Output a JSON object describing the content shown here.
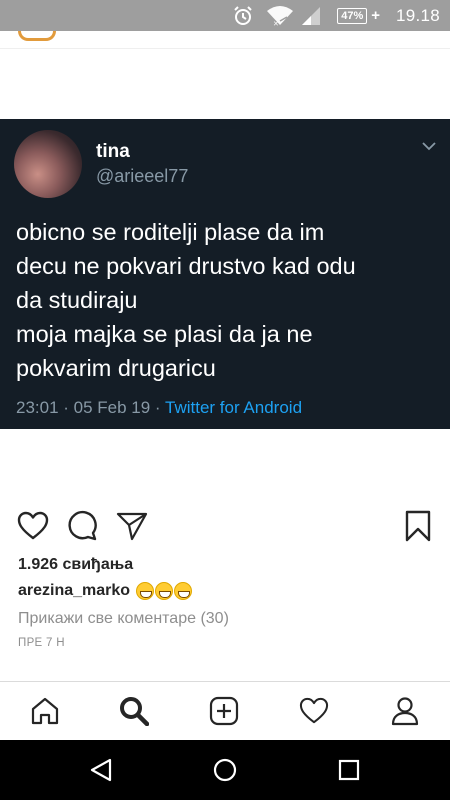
{
  "status_bar": {
    "time": "19.18",
    "battery": "47%",
    "icons": [
      "alarm-icon",
      "wifi-icon",
      "signal-icon",
      "battery-charging-icon"
    ]
  },
  "tweet": {
    "name": "tina",
    "handle": "@arieeel77",
    "text": "obicno se roditelji plase da im\ndecu ne pokvari drustvo kad odu\nda studiraju\nmoja majka se plasi da ja ne\npokvarim drugaricu",
    "timestamp": "23:01 · 05 Feb 19 · ",
    "source": "Twitter for Android"
  },
  "post": {
    "likes": "1.926 свиђања",
    "caption_user": "arezina_marko",
    "caption_emojis": [
      "laughing-emoji",
      "laughing-emoji",
      "laughing-emoji"
    ],
    "view_comments": "Прикажи све коментаре (30)",
    "time_ago": "ПРЕ 7 Н"
  },
  "bottom_nav": [
    "home-icon",
    "search-icon",
    "add-post-icon",
    "activity-heart-icon",
    "profile-icon"
  ],
  "system_nav": [
    "back-icon",
    "home-circle-icon",
    "recents-icon"
  ],
  "colors": {
    "tweet_bg": "#141d26",
    "link_blue": "#1da1f2",
    "muted": "#8899a6",
    "status_bar": "#9e9e9e"
  }
}
